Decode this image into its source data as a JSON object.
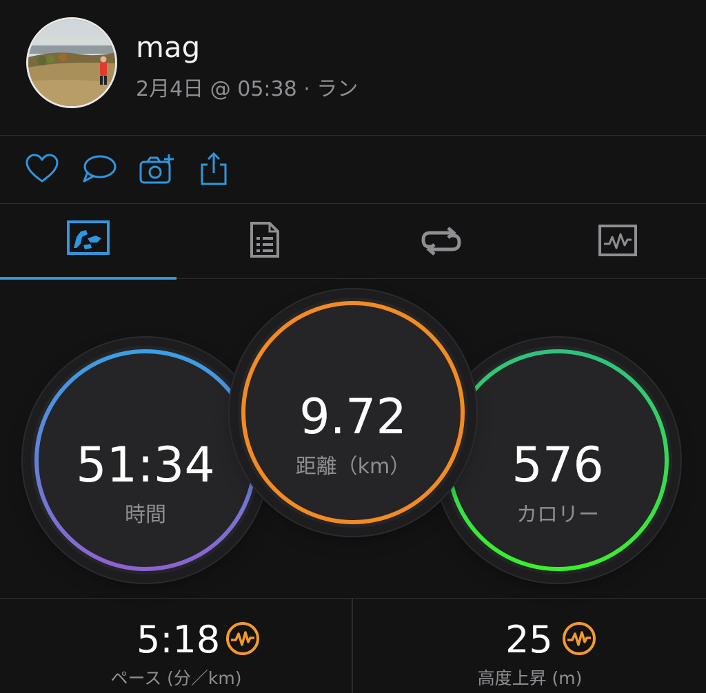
{
  "user": {
    "name": "mag",
    "meta": "2月4日 @ 05:38 · ラン"
  },
  "actions": [
    {
      "icon": "heart-icon"
    },
    {
      "icon": "comment-icon"
    },
    {
      "icon": "add-photo-icon"
    },
    {
      "icon": "share-icon"
    }
  ],
  "tabs": [
    {
      "icon": "overview-map-icon",
      "active": true
    },
    {
      "icon": "stats-sheet-icon",
      "active": false
    },
    {
      "icon": "laps-icon",
      "active": false
    },
    {
      "icon": "chart-icon",
      "active": false
    }
  ],
  "stats": {
    "time": {
      "value": "51:34",
      "label": "時間"
    },
    "distance": {
      "value": "9.72",
      "label": "距離（km）"
    },
    "calories": {
      "value": "576",
      "label": "カロリー"
    }
  },
  "bottom": {
    "pace": {
      "value": "5:18",
      "label": "ペース (分／km)"
    },
    "elevation": {
      "value": "25",
      "label": "高度上昇 (m)"
    }
  },
  "colors": {
    "accent_blue": "#2f97df",
    "ring_time_start": "#3a9fe4",
    "ring_time_end": "#8d63d0",
    "ring_distance": "#f38a22",
    "ring_calories_start": "#2ec27e",
    "ring_calories_end": "#39f02c",
    "pulse_orange": "#f29a2e"
  }
}
